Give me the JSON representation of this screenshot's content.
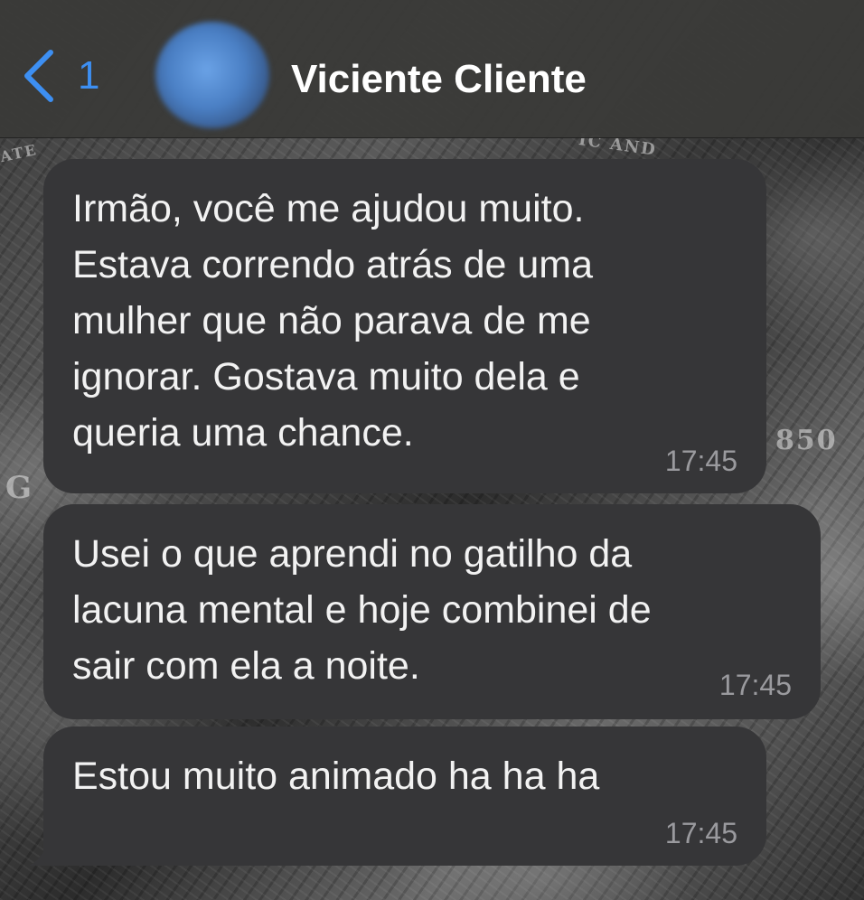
{
  "header": {
    "back_count": "1",
    "contact_name": "Viciente Cliente"
  },
  "messages": [
    {
      "text": "Irmão, você me ajudou muito.\nEstava correndo atrás de uma\nmulher que não parava de me\nignorar. Gostava muito dela e\nqueria uma chance.",
      "time": "17:45"
    },
    {
      "text": "Usei o que aprendi no gatilho da\nlacuna mental e hoje combinei de\nsair com ela a noite.",
      "time": "17:45"
    },
    {
      "text": "Estou muito animado ha ha ha",
      "time": "17:45"
    }
  ],
  "colors": {
    "accent": "#3d8ff2",
    "bubble": "#363638",
    "header": "#3a3a38",
    "timestamp": "#9a9a9e"
  },
  "icons": {
    "back": "chevron-left-icon"
  }
}
